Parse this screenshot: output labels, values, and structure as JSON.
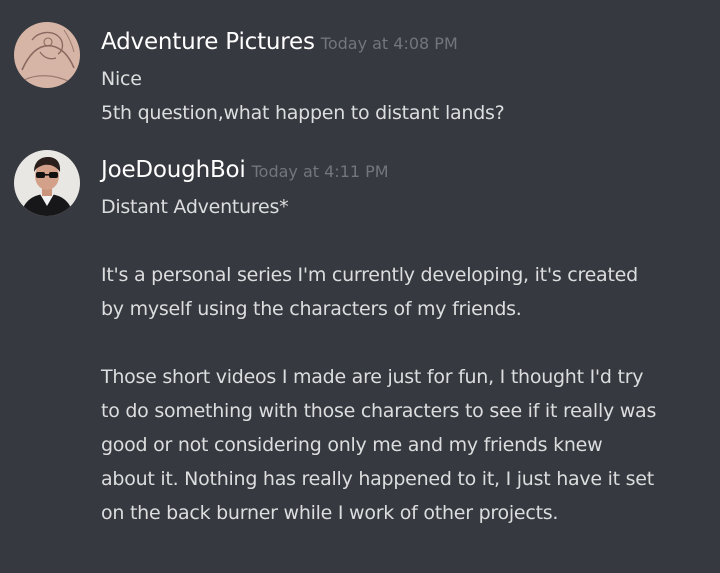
{
  "messages": [
    {
      "username": "Adventure Pictures",
      "timestamp": "Today at 4:08 PM",
      "lines": [
        "Nice",
        "5th question,what happen to distant lands?"
      ]
    },
    {
      "username": "JoeDoughBoi",
      "timestamp": "Today at 4:11 PM",
      "lines": [
        "Distant Adventures*",
        "",
        "It's a personal series I'm currently developing, it's created",
        "by myself using the characters of my friends.",
        "",
        "Those short videos I made are just for fun, I thought I'd try",
        "to do something with those characters to see if it really was",
        "good or not considering only me and my friends knew",
        "about it. Nothing has really happened to it, I just have it set",
        "on the back burner while I work of other projects."
      ]
    }
  ],
  "colors": {
    "background": "#36393f",
    "username": "#ffffff",
    "timestamp": "#72767d",
    "message_text": "#dcddde"
  }
}
